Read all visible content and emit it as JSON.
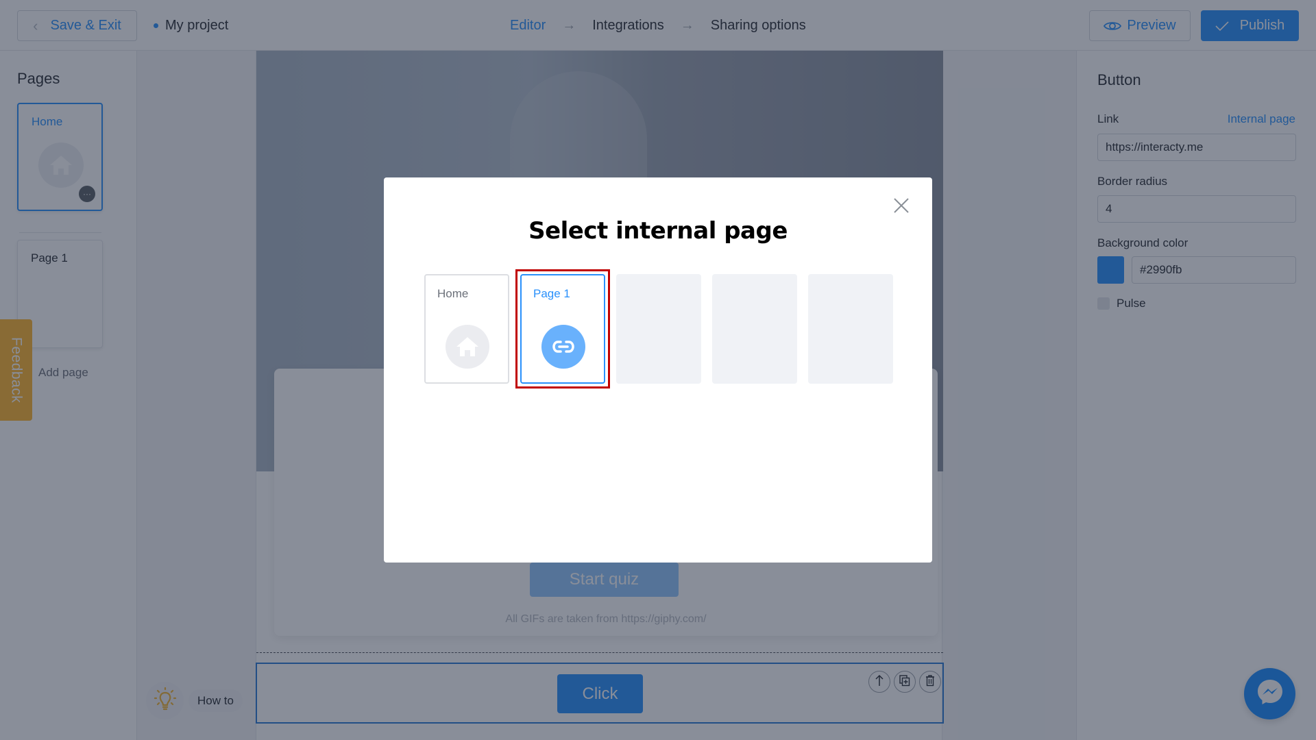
{
  "topbar": {
    "save_exit_label": "Save & Exit",
    "project_name": "My project",
    "steps": [
      {
        "label": "Editor",
        "active": true
      },
      {
        "label": "Integrations",
        "active": false
      },
      {
        "label": "Sharing options",
        "active": false
      }
    ],
    "preview_label": "Preview",
    "publish_label": "Publish"
  },
  "sidebar": {
    "title": "Pages",
    "pages": [
      {
        "label": "Home",
        "active": true
      },
      {
        "label": "Page 1",
        "active": false
      }
    ],
    "add_page_label": "Add page",
    "more_icon": "···"
  },
  "feedback_label": "Feedback",
  "howto_label": "How to",
  "canvas": {
    "start_quiz_label": "Start quiz",
    "giphy_note": "All GIFs are taken from https://giphy.com/",
    "click_button_label": "Click"
  },
  "right_panel": {
    "title": "Button",
    "link_label": "Link",
    "internal_page_link": "Internal page",
    "link_value": "https://interacty.me",
    "border_radius_label": "Border radius",
    "border_radius_value": "4",
    "background_color_label": "Background color",
    "background_color_value": "#2990fb",
    "pulse_label": "Pulse",
    "pulse_checked": false
  },
  "modal": {
    "title": "Select internal page",
    "pages": [
      {
        "label": "Home",
        "icon": "home-icon",
        "selected": false
      },
      {
        "label": "Page 1",
        "icon": "link-icon",
        "selected": true
      },
      {
        "label": "",
        "empty": true
      },
      {
        "label": "",
        "empty": true
      },
      {
        "label": "",
        "empty": true
      }
    ]
  },
  "colors": {
    "accent": "#2990fb",
    "feedback": "#ffb62e",
    "highlight": "#c00000",
    "messenger": "#1a8cff"
  }
}
